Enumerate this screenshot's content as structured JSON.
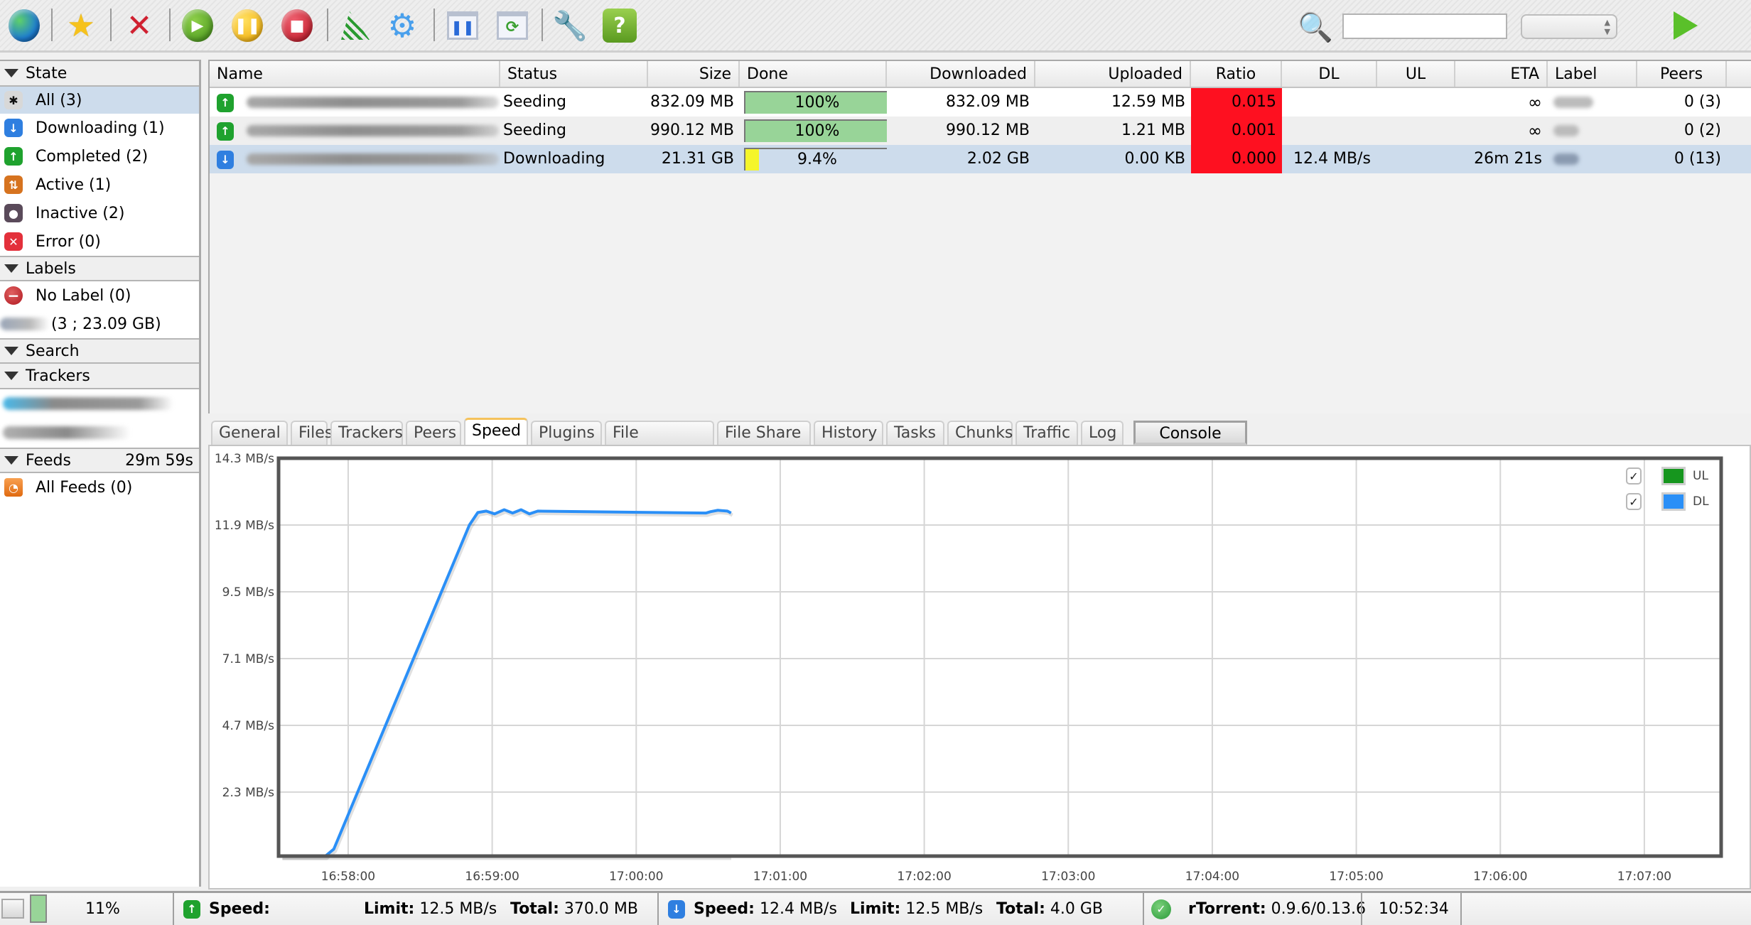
{
  "toolbar": {
    "buttons": [
      {
        "name": "globe",
        "icon": "globe-icon"
      },
      {
        "name": "favorites",
        "icon": "star-icon"
      },
      {
        "name": "remove",
        "icon": "remove-x-icon"
      },
      {
        "name": "start",
        "icon": "play-icon"
      },
      {
        "name": "pause",
        "icon": "pause-icon"
      },
      {
        "name": "stop",
        "icon": "stop-icon"
      },
      {
        "name": "rss",
        "icon": "rss-icon"
      },
      {
        "name": "settings",
        "icon": "gear-icon"
      },
      {
        "name": "pause-all",
        "icon": "window-pause-icon"
      },
      {
        "name": "refresh",
        "icon": "window-refresh-icon"
      },
      {
        "name": "tools",
        "icon": "tools-icon"
      },
      {
        "name": "help",
        "icon": "help-icon"
      }
    ],
    "search_value": "",
    "search_placeholder": "",
    "filter_selected": "",
    "go_icon": "play-arrow-icon",
    "help_glyph": "?"
  },
  "sidebar": {
    "state": {
      "title": "State",
      "items": [
        {
          "label": "All (3)",
          "icon": "all-icon",
          "color": "#d8d8d8",
          "glyph": "✱",
          "selected": true
        },
        {
          "label": "Downloading (1)",
          "icon": "downloading-icon",
          "color": "#2f7fe0",
          "glyph": "↓",
          "selected": false
        },
        {
          "label": "Completed (2)",
          "icon": "completed-icon",
          "color": "#1fa22e",
          "glyph": "↑",
          "selected": false
        },
        {
          "label": "Active (1)",
          "icon": "active-icon",
          "color": "#d6731f",
          "glyph": "⇅",
          "selected": false
        },
        {
          "label": "Inactive (2)",
          "icon": "inactive-icon",
          "color": "#5a4a5a",
          "glyph": "●",
          "selected": false
        },
        {
          "label": "Error (0)",
          "icon": "error-icon",
          "color": "#e3303b",
          "glyph": "✕",
          "selected": false
        }
      ]
    },
    "labels": {
      "title": "Labels",
      "items": [
        {
          "label": "No Label (0)",
          "icon": "no-label-icon"
        },
        {
          "label": "(3 ; 23.09 GB)",
          "icon": "label-icon"
        }
      ]
    },
    "search": {
      "title": "Search"
    },
    "trackers": {
      "title": "Trackers"
    },
    "feeds": {
      "title": "Feeds",
      "timer": "29m 59s",
      "items": [
        {
          "label": "All Feeds (0)",
          "icon": "rss-feed-icon"
        }
      ]
    }
  },
  "table": {
    "columns": [
      "Name",
      "Status",
      "Size",
      "Done",
      "Downloaded",
      "Uploaded",
      "Ratio",
      "DL",
      "UL",
      "ETA",
      "Label",
      "Peers"
    ],
    "rows": [
      {
        "name": "",
        "status": "Seeding",
        "size": "832.09 MB",
        "done": "100%",
        "done_fraction": 1.0,
        "downloaded": "832.09 MB",
        "uploaded": "12.59 MB",
        "ratio": "0.015",
        "dl": "",
        "ul": "",
        "eta": "∞",
        "label": "",
        "peers": "0 (3)",
        "state": "seeding",
        "selected": false
      },
      {
        "name": "",
        "status": "Seeding",
        "size": "990.12 MB",
        "done": "100%",
        "done_fraction": 1.0,
        "downloaded": "990.12 MB",
        "uploaded": "1.21 MB",
        "ratio": "0.001",
        "dl": "",
        "ul": "",
        "eta": "∞",
        "label": "",
        "peers": "0 (2)",
        "state": "seeding",
        "selected": false
      },
      {
        "name": "",
        "status": "Downloading",
        "size": "21.31 GB",
        "done": "9.4%",
        "done_fraction": 0.094,
        "downloaded": "2.02 GB",
        "uploaded": "0.00 KB",
        "ratio": "0.000",
        "dl": "12.4 MB/s",
        "ul": "",
        "eta": "26m 21s",
        "label": "",
        "peers": "0 (13)",
        "state": "downloading",
        "selected": true
      }
    ]
  },
  "tabs": [
    {
      "label": "General",
      "active": false
    },
    {
      "label": "Files",
      "active": false
    },
    {
      "label": "Trackers",
      "active": false
    },
    {
      "label": "Peers",
      "active": false
    },
    {
      "label": "Speed",
      "active": true
    },
    {
      "label": "Plugins",
      "active": false
    },
    {
      "label": "File Manager",
      "active": false
    },
    {
      "label": "File Share",
      "active": false
    },
    {
      "label": "History",
      "active": false
    },
    {
      "label": "Tasks",
      "active": false
    },
    {
      "label": "Chunks",
      "active": false
    },
    {
      "label": "Traffic",
      "active": false
    },
    {
      "label": "Log",
      "active": false
    },
    {
      "label": "Console",
      "active": false
    }
  ],
  "colors": {
    "ul": "#16961e",
    "dl": "#2a8ff7",
    "ratio_bad": "#fe1020",
    "progress_complete": "#98d498",
    "progress_partial": "#f5f52a",
    "selection": "#cddcec"
  },
  "chart_data": {
    "type": "line",
    "title": "",
    "xlabel": "",
    "ylabel": "",
    "x_unit": "time (seconds relative to 16:58:00)",
    "xlim": [
      -29,
      572
    ],
    "ylim": [
      0,
      14.3
    ],
    "yticks": [
      2.3,
      4.7,
      7.1,
      9.5,
      11.9,
      14.3
    ],
    "ytick_labels": [
      "2.3 MB/s",
      "4.7 MB/s",
      "7.1 MB/s",
      "9.5 MB/s",
      "11.9 MB/s",
      "14.3 MB/s"
    ],
    "xticks": [
      0,
      60,
      120,
      180,
      240,
      300,
      360,
      420,
      480,
      540
    ],
    "xtick_labels": [
      "16:58:00",
      "16:59:00",
      "17:00:00",
      "17:01:00",
      "17:02:00",
      "17:03:00",
      "17:04:00",
      "17:05:00",
      "17:06:00",
      "17:07:00"
    ],
    "grid": true,
    "legend": "top-right",
    "series": [
      {
        "name": "UL",
        "checked": true,
        "color": "#16961e",
        "x": [
          -28,
          159
        ],
        "y": [
          0,
          0
        ]
      },
      {
        "name": "DL",
        "checked": true,
        "color": "#2a8ff7",
        "x": [
          -28,
          -9.5,
          -6,
          50.5,
          54,
          57.5,
          61,
          65,
          68.5,
          72,
          75.5,
          79,
          149,
          151,
          154,
          158,
          159.5
        ],
        "y": [
          0,
          0,
          0.25,
          11.9,
          12.35,
          12.4,
          12.3,
          12.45,
          12.33,
          12.45,
          12.3,
          12.4,
          12.33,
          12.38,
          12.43,
          12.4,
          12.33
        ]
      }
    ]
  },
  "statusbar": {
    "disk_percent": "11%",
    "disk_fraction": 0.11,
    "upload": {
      "speed_label": "Speed:",
      "speed": "",
      "limit_label": "Limit:",
      "limit": "12.5 MB/s",
      "total_label": "Total:",
      "total": "370.0 MB"
    },
    "download": {
      "speed_label": "Speed:",
      "speed": "12.4 MB/s",
      "limit_label": "Limit:",
      "limit": "12.5 MB/s",
      "total_label": "Total:",
      "total": "4.0 GB"
    },
    "client_label": "rTorrent:",
    "client_version": "0.9.6/0.13.6",
    "clock": "10:52:34"
  }
}
